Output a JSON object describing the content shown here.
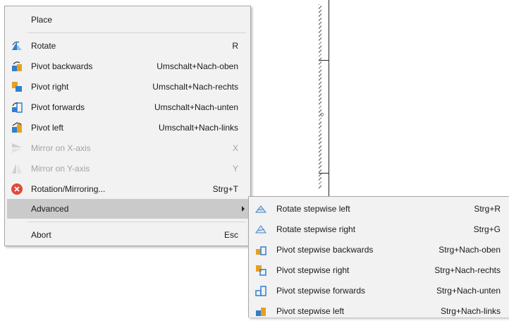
{
  "main_menu": {
    "items": [
      {
        "label": "Place",
        "shortcut": ""
      },
      {
        "label": "Rotate",
        "shortcut": "R",
        "icon": "rotate-icon"
      },
      {
        "label": "Pivot backwards",
        "shortcut": "Umschalt+Nach-oben",
        "icon": "pivot-backwards-icon"
      },
      {
        "label": "Pivot right",
        "shortcut": "Umschalt+Nach-rechts",
        "icon": "pivot-right-icon"
      },
      {
        "label": "Pivot forwards",
        "shortcut": "Umschalt+Nach-unten",
        "icon": "pivot-forwards-icon"
      },
      {
        "label": "Pivot left",
        "shortcut": "Umschalt+Nach-links",
        "icon": "pivot-left-icon"
      },
      {
        "label": "Mirror on X-axis",
        "shortcut": "X",
        "icon": "mirror-x-icon",
        "disabled": true
      },
      {
        "label": "Mirror on Y-axis",
        "shortcut": "Y",
        "icon": "mirror-y-icon",
        "disabled": true
      },
      {
        "label": "Rotation/Mirroring...",
        "shortcut": "Strg+T",
        "icon": "rotation-mirroring-icon"
      },
      {
        "label": "Advanced",
        "shortcut": "",
        "highlighted": true
      },
      {
        "label": "Abort",
        "shortcut": "Esc"
      }
    ]
  },
  "sub_menu": {
    "items": [
      {
        "label": "Rotate stepwise left",
        "shortcut": "Strg+R",
        "icon": "rotate-stepwise-left-icon"
      },
      {
        "label": "Rotate stepwise right",
        "shortcut": "Strg+G",
        "icon": "rotate-stepwise-right-icon"
      },
      {
        "label": "Pivot stepwise backwards",
        "shortcut": "Strg+Nach-oben",
        "icon": "pivot-stepwise-backwards-icon"
      },
      {
        "label": "Pivot stepwise right",
        "shortcut": "Strg+Nach-rechts",
        "icon": "pivot-stepwise-right-icon"
      },
      {
        "label": "Pivot stepwise forwards",
        "shortcut": "Strg+Nach-unten",
        "icon": "pivot-stepwise-forwards-icon"
      },
      {
        "label": "Pivot stepwise left",
        "shortcut": "Strg+Nach-links",
        "icon": "pivot-stepwise-left-icon"
      }
    ]
  },
  "canvas": {
    "dimension_label": "0"
  },
  "colors": {
    "menu_bg": "#f2f2f2",
    "highlight": "#cacaca",
    "disabled_text": "#a3a3a3",
    "icon_blue": "#2f7fd0",
    "icon_orange": "#e8a020",
    "cancel_red": "#e04a3a"
  }
}
